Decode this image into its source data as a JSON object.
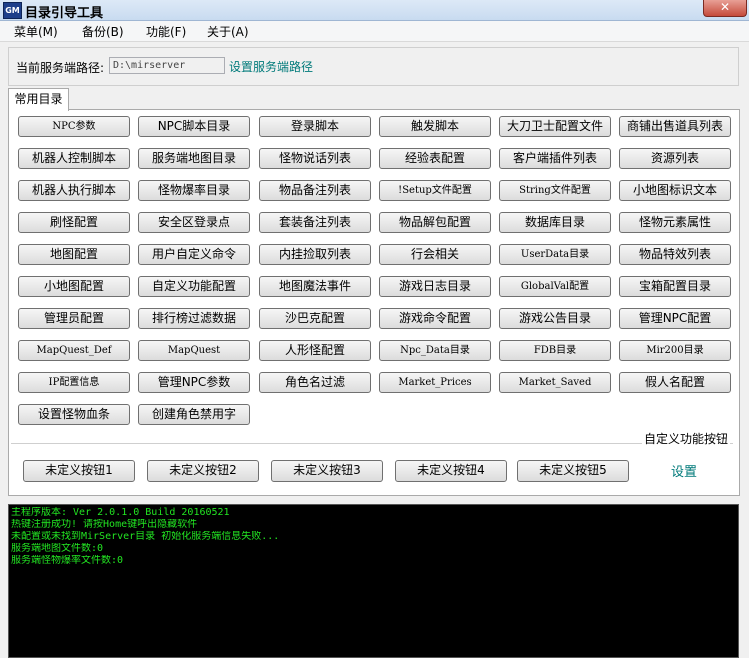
{
  "window": {
    "icon_text": "GM",
    "title": "目录引导工具",
    "close_label": "✕"
  },
  "menu": [
    "菜单(M)",
    "备份(B)",
    "功能(F)",
    "关于(A)"
  ],
  "server": {
    "label": "当前服务端路径:",
    "path": "D:\\mirserver",
    "set_link": "设置服务端路径"
  },
  "tab": {
    "label": "常用目录"
  },
  "directory_buttons": [
    [
      "NPC参数",
      "NPC脚本目录",
      "登录脚本",
      "触发脚本",
      "大刀卫士配置文件",
      "商铺出售道具列表"
    ],
    [
      "机器人控制脚本",
      "服务端地图目录",
      "怪物说话列表",
      "经验表配置",
      "客户端插件列表",
      "资源列表"
    ],
    [
      "机器人执行脚本",
      "怪物爆率目录",
      "物品备注列表",
      "!Setup文件配置",
      "String文件配置",
      "小地图标识文本"
    ],
    [
      "刷怪配置",
      "安全区登录点",
      "套装备注列表",
      "物品解包配置",
      "数据库目录",
      "怪物元素属性"
    ],
    [
      "地图配置",
      "用户自定义命令",
      "内挂捡取列表",
      "行会相关",
      "UserData目录",
      "物品特效列表"
    ],
    [
      "小地图配置",
      "自定义功能配置",
      "地图魔法事件",
      "游戏日志目录",
      "GlobalVal配置",
      "宝箱配置目录"
    ],
    [
      "管理员配置",
      "排行榜过滤数据",
      "沙巴克配置",
      "游戏命令配置",
      "游戏公告目录",
      "管理NPC配置"
    ],
    [
      "MapQuest_Def",
      "MapQuest",
      "人形怪配置",
      "Npc_Data目录",
      "FDB目录",
      "Mir200目录"
    ],
    [
      "IP配置信息",
      "管理NPC参数",
      "角色名过滤",
      "Market_Prices",
      "Market_Saved",
      "假人名配置"
    ],
    [
      "设置怪物血条",
      "创建角色禁用字"
    ]
  ],
  "custom": {
    "title": "自定义功能按钮",
    "buttons": [
      "未定义按钮1",
      "未定义按钮2",
      "未定义按钮3",
      "未定义按钮4",
      "未定义按钮5"
    ],
    "settings_label": "设置"
  },
  "console_lines": [
    "主程序版本: Ver 2.0.1.0 Build 20160521",
    "热键注册成功! 请按Home键呼出隐藏软件",
    "未配置或未找到MirServer目录 初始化服务端信息失败...",
    "服务端地图文件数:0",
    "服务端怪物爆率文件数:0"
  ],
  "colors": {
    "console_text": "#22e422",
    "console_bg": "#000000",
    "link": "#007a7a"
  }
}
